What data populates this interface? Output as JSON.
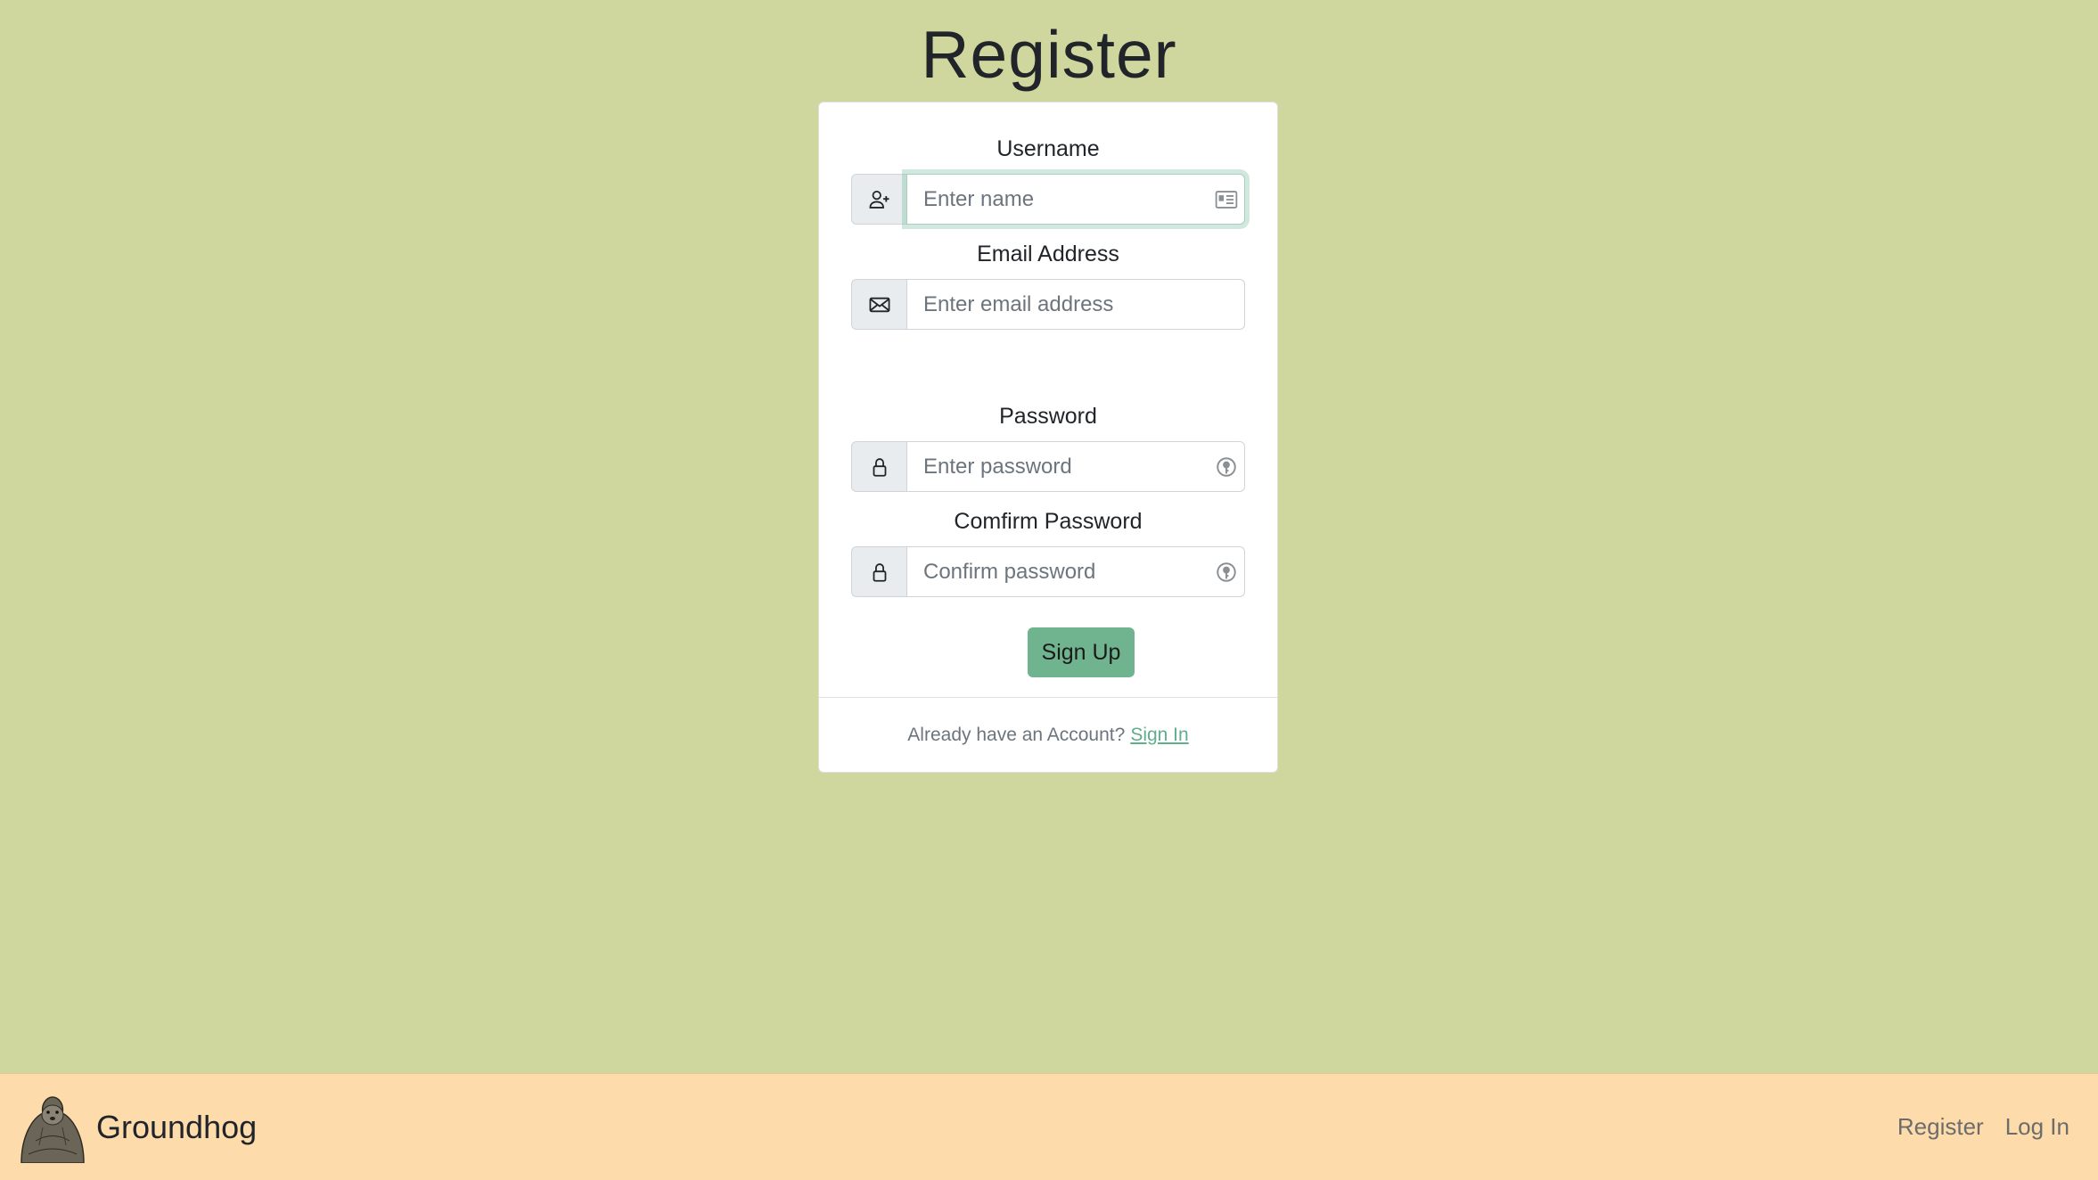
{
  "page": {
    "title": "Register"
  },
  "form": {
    "username": {
      "label": "Username",
      "placeholder": "Enter name",
      "icon": "person-plus-icon"
    },
    "email": {
      "label": "Email Address",
      "placeholder": "Enter email address",
      "icon": "envelope-icon"
    },
    "password": {
      "label": "Password",
      "placeholder": "Enter password",
      "icon": "lock-icon"
    },
    "confirm": {
      "label": "Comfirm Password",
      "placeholder": "Confirm password",
      "icon": "lock-icon"
    },
    "submit_label": "Sign Up"
  },
  "card_footer": {
    "text": "Already have an Account?",
    "link_label": "Sign In"
  },
  "navbar": {
    "brand": "Groundhog",
    "links": [
      "Register",
      "Log In"
    ]
  },
  "colors": {
    "background": "#cfd79e",
    "navbar": "#fedbaa",
    "accent": "#6fb48e"
  }
}
